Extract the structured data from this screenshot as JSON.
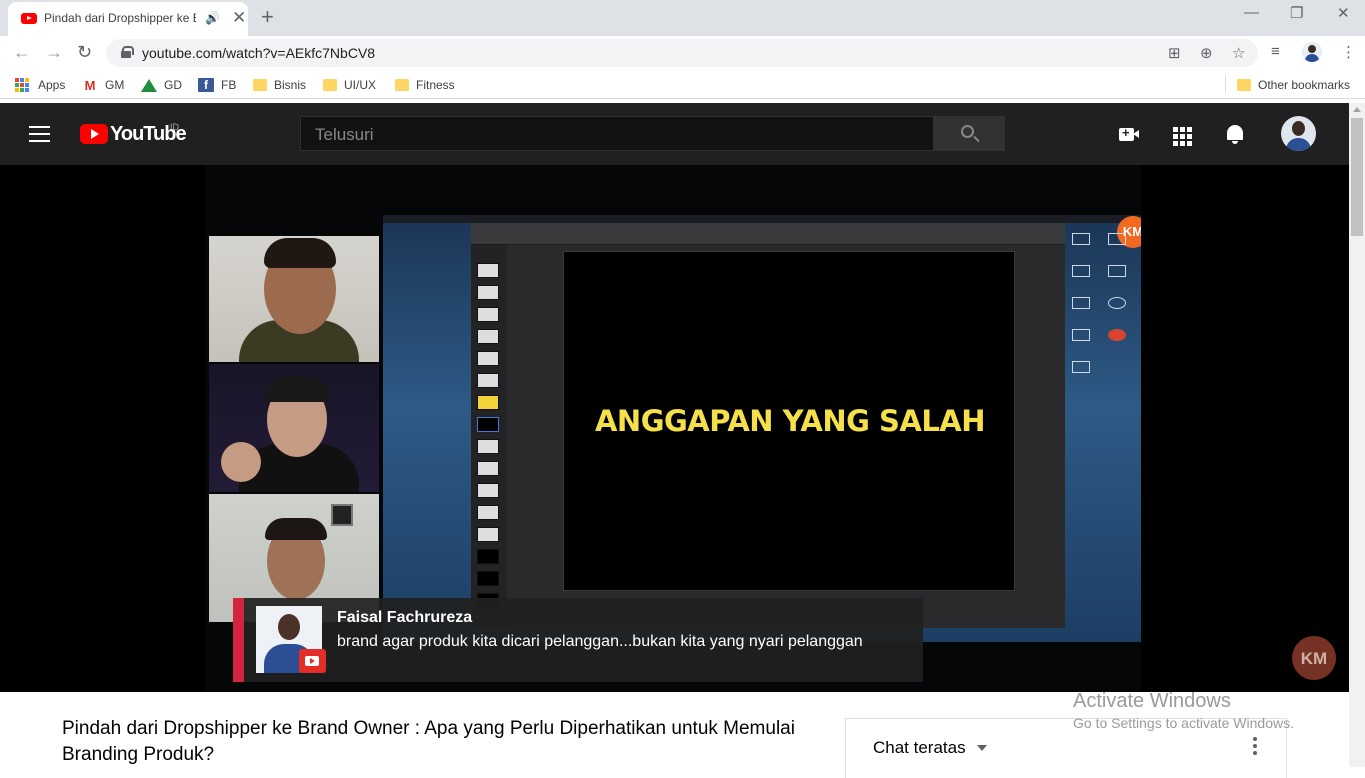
{
  "browser": {
    "tab_title": "Pindah dari Dropshipper ke Brand Owner",
    "url": "youtube.com/watch?v=AEkfc7NbCV8",
    "bookmarks": [
      {
        "label": "Apps",
        "icon": "apps-grid-icon"
      },
      {
        "label": "GM",
        "icon": "gmail-icon"
      },
      {
        "label": "GD",
        "icon": "google-drive-icon"
      },
      {
        "label": "FB",
        "icon": "facebook-icon"
      },
      {
        "label": "Bisnis",
        "icon": "folder-icon"
      },
      {
        "label": "UI/UX",
        "icon": "folder-icon"
      },
      {
        "label": "Fitness",
        "icon": "folder-icon"
      }
    ],
    "other_bookmarks": "Other bookmarks"
  },
  "youtube": {
    "wordmark": "YouTube",
    "country": "ID",
    "search_placeholder": "Telusuri"
  },
  "player": {
    "slide_text": "ANGGAPAN YANG SALAH",
    "channel_badge": "KM",
    "watermark": "KM",
    "chat_overlay": {
      "name": "Faisal Fachrureza",
      "message": "brand agar produk kita dicari pelanggan...bukan kita yang nyari pelanggan"
    }
  },
  "video": {
    "title": "Pindah dari Dropshipper ke Brand Owner : Apa yang Perlu Diperhatikan untuk Memulai Branding Produk?"
  },
  "live_chat": {
    "mode_label": "Chat teratas"
  },
  "os_overlay": {
    "line1": "Activate Windows",
    "line2": "Go to Settings to activate Windows."
  },
  "colors": {
    "youtube_red": "#ff0000",
    "header_bg": "#202020",
    "slide_text": "#f5e04a",
    "chat_accent": "#d4243f"
  }
}
